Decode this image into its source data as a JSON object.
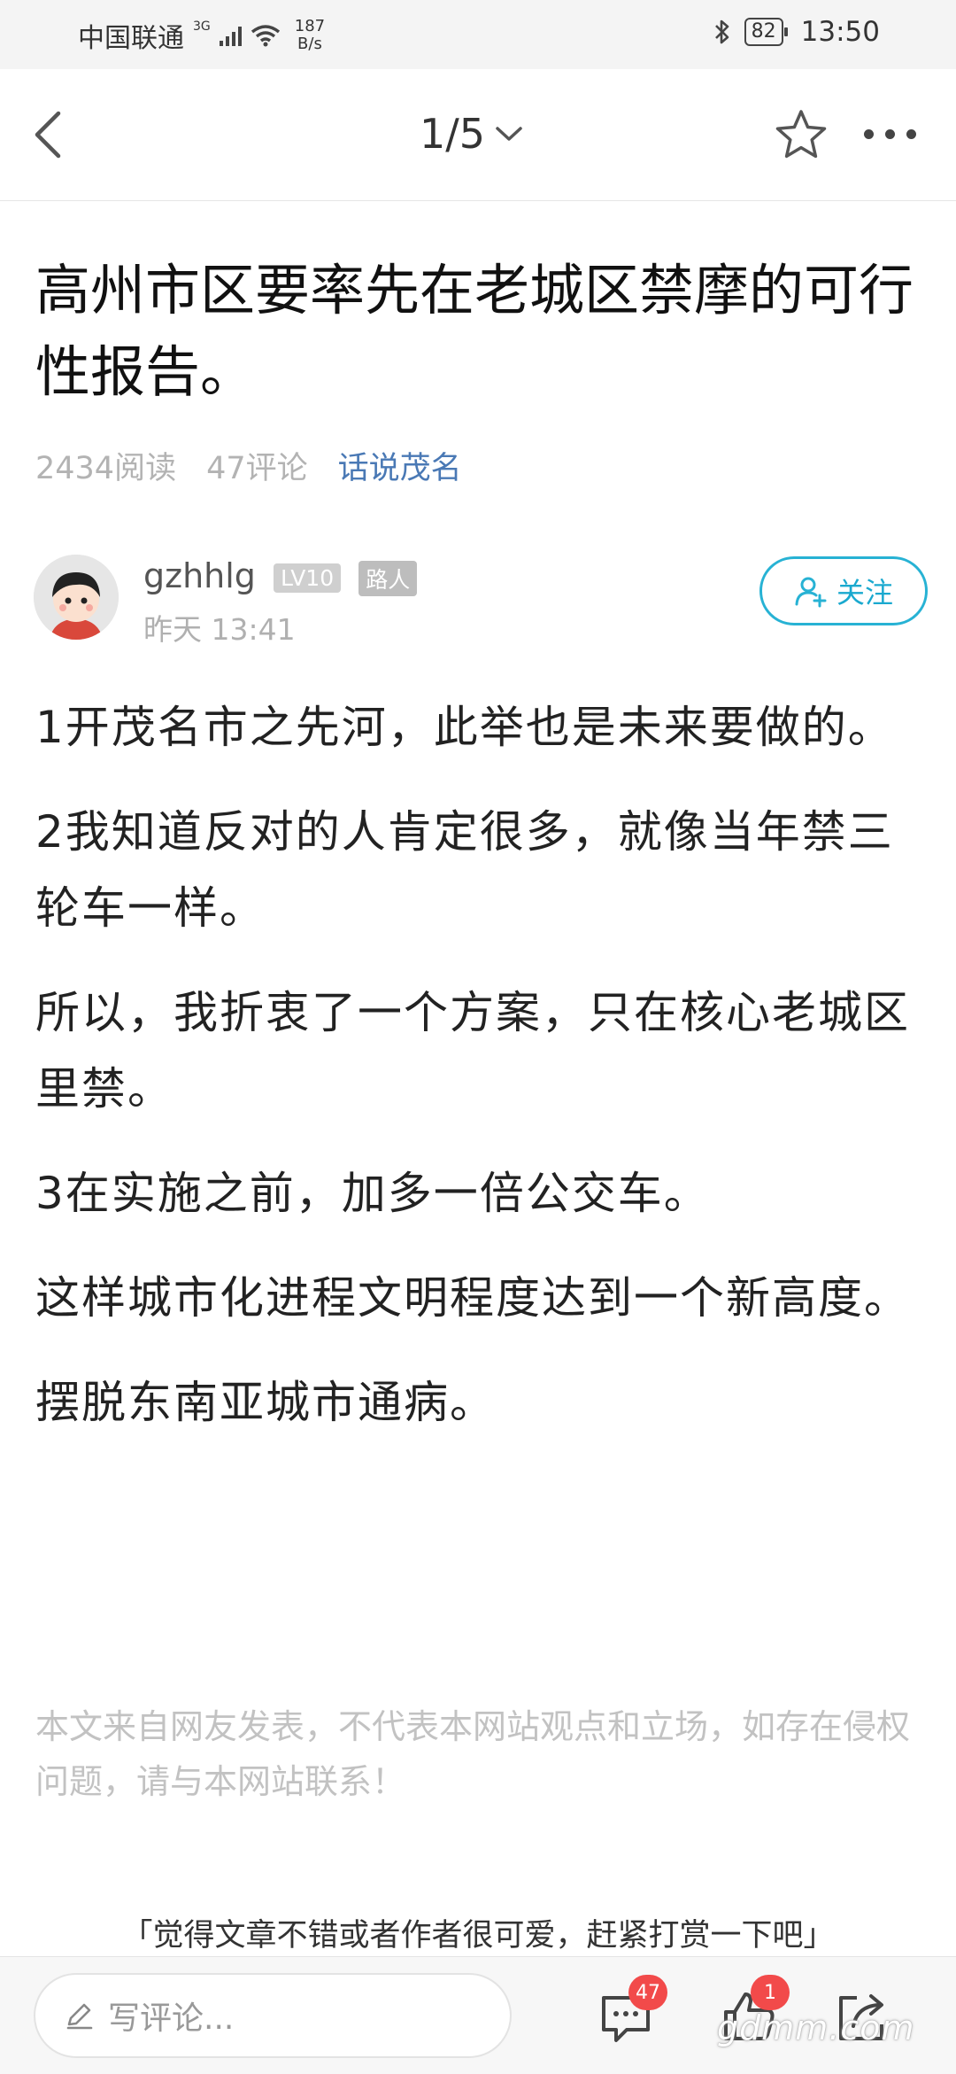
{
  "status_bar": {
    "carrier": "中国联通",
    "network": "3G",
    "speed_value": "187",
    "speed_unit": "B/s",
    "battery": "82",
    "time": "13:50"
  },
  "nav": {
    "pager": "1/5"
  },
  "article": {
    "title": "高州市区要率先在老城区禁摩的可行性报告。",
    "reads": "2434阅读",
    "comments": "47评论",
    "forum": "话说茂名"
  },
  "author": {
    "name": "gzhhlg",
    "level": "LV10",
    "role": "路人",
    "time": "昨天 13:41",
    "follow_label": "关注"
  },
  "body": {
    "paragraphs": [
      "1开茂名市之先河，此举也是未来要做的。",
      "2我知道反对的人肯定很多，就像当年禁三轮车一样。",
      "所以，我折衷了一个方案，只在核心老城区里禁。",
      "3在实施之前，加多一倍公交车。",
      "这样城市化进程文明程度达到一个新高度。",
      "摆脱东南亚城市通病。"
    ]
  },
  "disclaimer": "本文来自网友发表，不代表本网站观点和立场，如存在侵权问题，请与本网站联系！",
  "reward_prompt": "「觉得文章不错或者作者很可爱，赶紧打赏一下吧」",
  "bottom_bar": {
    "comment_placeholder": "写评论...",
    "comment_count": "47",
    "like_count": "1",
    "watermark": "gdmm.com"
  },
  "colors": {
    "accent": "#27b2d4",
    "forum_link": "#4a79b5",
    "badge_red": "#f24a4a"
  }
}
